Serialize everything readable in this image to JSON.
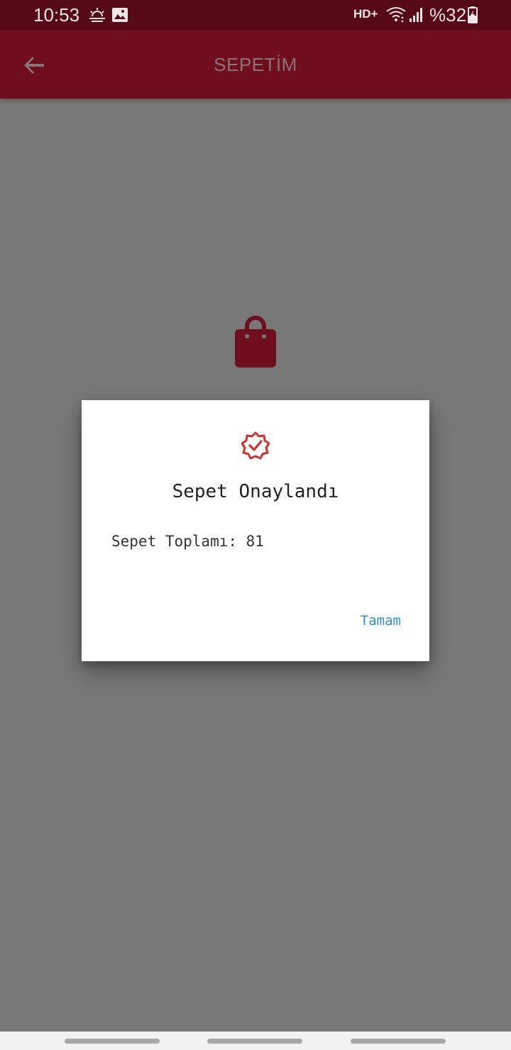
{
  "status_bar": {
    "time": "10:53",
    "network": "HD+",
    "battery": "%32",
    "icons": [
      "weather-sunrise-icon",
      "gallery-icon",
      "wifi-icon",
      "signal-icon",
      "battery-charging-icon"
    ]
  },
  "app_bar": {
    "title": "SEPETİM",
    "back_icon": "arrow-left-icon",
    "color": "#6f0e1c"
  },
  "empty_cart": {
    "icon": "shopping-bag-icon",
    "color": "#6f0e1c"
  },
  "dialog": {
    "icon": "verified-badge-icon",
    "icon_color": "#d32f2f",
    "title": "Sepet Onaylandı",
    "body": "Sepet Toplamı: 81",
    "ok_label": "Tamam",
    "ok_color": "#2a8fd0"
  }
}
